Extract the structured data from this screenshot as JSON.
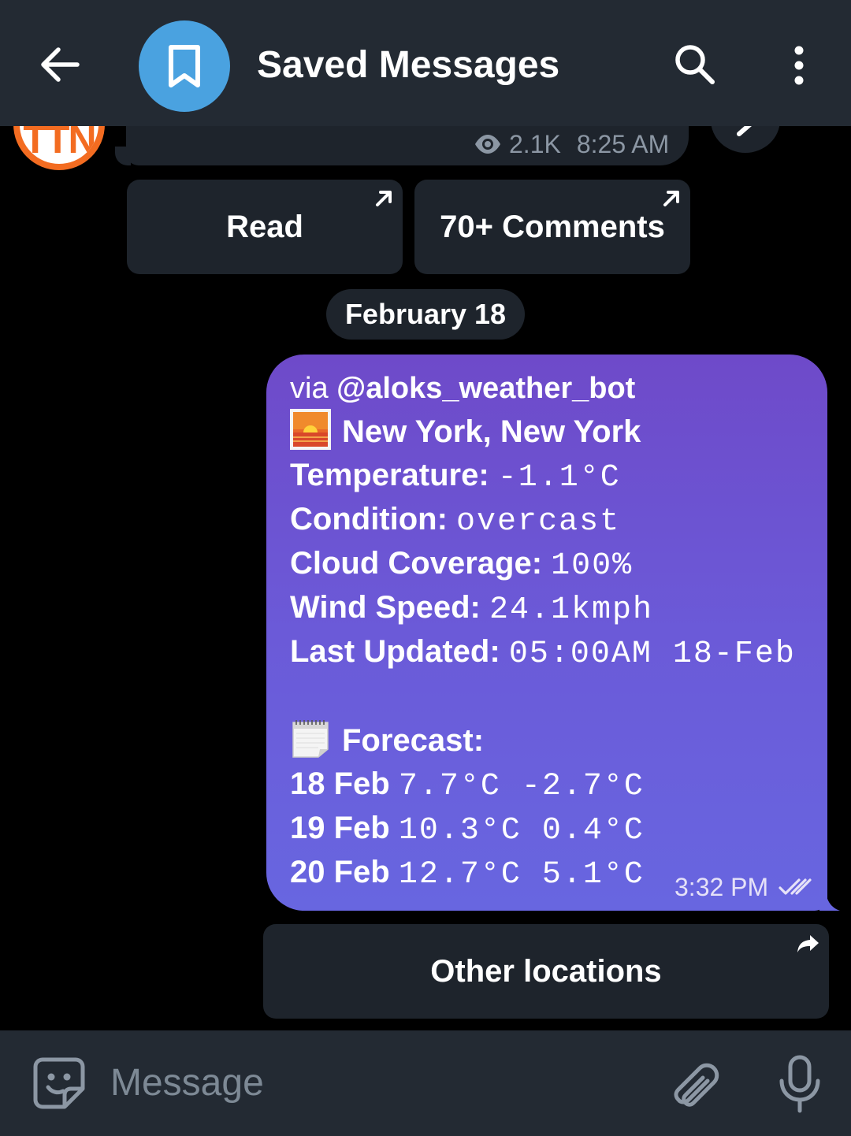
{
  "header": {
    "title": "Saved Messages",
    "back_icon": "arrow-left-icon",
    "avatar_icon": "bookmark-icon",
    "search_icon": "search-icon",
    "menu_icon": "more-vertical-icon"
  },
  "previous_message": {
    "avatar_text": "TTN",
    "views": "2.1K",
    "time": "8:25 AM"
  },
  "buttons": {
    "read": "Read",
    "comments": "70+ Comments",
    "other_locations": "Other locations"
  },
  "date_chip": "February 18",
  "weather_message": {
    "via_prefix": "via",
    "via_bot": "@aloks_weather_bot",
    "location": "New York, New York",
    "temperature_label": "Temperature:",
    "temperature_value": "-1.1°C",
    "condition_label": "Condition:",
    "condition_value": "overcast",
    "cloud_label": "Cloud Coverage:",
    "cloud_value": "100%",
    "wind_label": "Wind Speed:",
    "wind_value": "24.1kmph",
    "updated_label": "Last Updated:",
    "updated_value": "05:00AM 18-Feb",
    "forecast_label": "Forecast:",
    "forecast": [
      {
        "day": "18 Feb",
        "temps": "7.7°C -2.7°C"
      },
      {
        "day": "19 Feb",
        "temps": "10.3°C 0.4°C"
      },
      {
        "day": "20 Feb",
        "temps": "12.7°C 5.1°C"
      }
    ],
    "time": "3:32 PM"
  },
  "input": {
    "placeholder": "Message"
  },
  "colors": {
    "header_bg": "#232a33",
    "bubble_top": "#6e4ac9",
    "bubble_bottom": "#6866e0",
    "button_bg": "#1e242c",
    "avatar_blue": "#4aa2e0"
  }
}
